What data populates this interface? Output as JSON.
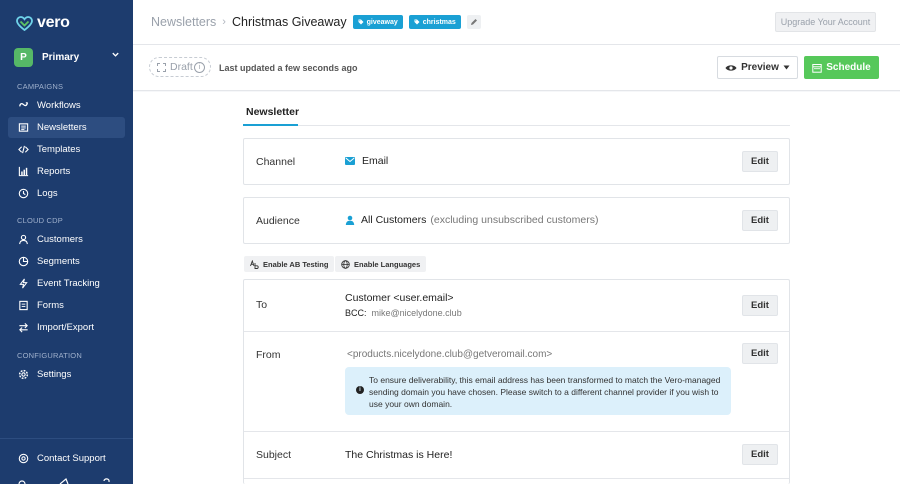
{
  "app": {
    "logo_text": "vero"
  },
  "workspace": {
    "avatar": "P",
    "name": "Primary"
  },
  "sidebar": {
    "sections": {
      "campaigns": "CAMPAIGNS",
      "cdp": "CLOUD CDP",
      "config": "CONFIGURATION"
    },
    "items": [
      {
        "label": "Workflows",
        "icon": "workflow-icon"
      },
      {
        "label": "Newsletters",
        "icon": "newsletter-icon",
        "active": true
      },
      {
        "label": "Templates",
        "icon": "code-icon"
      },
      {
        "label": "Reports",
        "icon": "chart-icon"
      },
      {
        "label": "Logs",
        "icon": "clock-icon"
      },
      {
        "label": "Customers",
        "icon": "user-icon"
      },
      {
        "label": "Segments",
        "icon": "pie-icon"
      },
      {
        "label": "Event Tracking",
        "icon": "bolt-icon"
      },
      {
        "label": "Forms",
        "icon": "form-icon"
      },
      {
        "label": "Import/Export",
        "icon": "transfer-icon"
      },
      {
        "label": "Settings",
        "icon": "gear-icon"
      }
    ],
    "support": "Contact Support"
  },
  "header": {
    "breadcrumb_parent": "Newsletters",
    "title": "Christmas Giveaway",
    "tags": [
      "giveaway",
      "christmas"
    ],
    "upgrade": "Upgrade Your Account"
  },
  "toolbar": {
    "status": "Draft",
    "updated": "Last updated a few seconds ago",
    "preview": "Preview",
    "schedule": "Schedule"
  },
  "main": {
    "tab": "Newsletter",
    "channel": {
      "label": "Channel",
      "value": "Email",
      "edit": "Edit"
    },
    "audience": {
      "label": "Audience",
      "value": "All Customers",
      "note": "(excluding unsubscribed customers)",
      "edit": "Edit"
    },
    "options": {
      "ab": "Enable AB Testing",
      "languages": "Enable Languages"
    },
    "to": {
      "label": "To",
      "value": "Customer <user.email>",
      "bcc_label": "BCC:",
      "bcc_value": "mike@nicelydone.club",
      "edit": "Edit"
    },
    "from": {
      "label": "From",
      "value": "<products.nicelydone.club@getveromail.com>",
      "notice": "To ensure deliverability, this email address has been transformed to match the Vero-managed sending domain you have chosen. Please switch to a different channel provider if you wish to use your own domain.",
      "edit": "Edit"
    },
    "subject": {
      "label": "Subject",
      "value": "The Christmas is Here!",
      "edit": "Edit"
    }
  },
  "colors": {
    "sidebar": "#1d3c6e",
    "accent": "#1aa0d4",
    "schedule": "#56c85a",
    "notice": "#dcf0fb"
  }
}
